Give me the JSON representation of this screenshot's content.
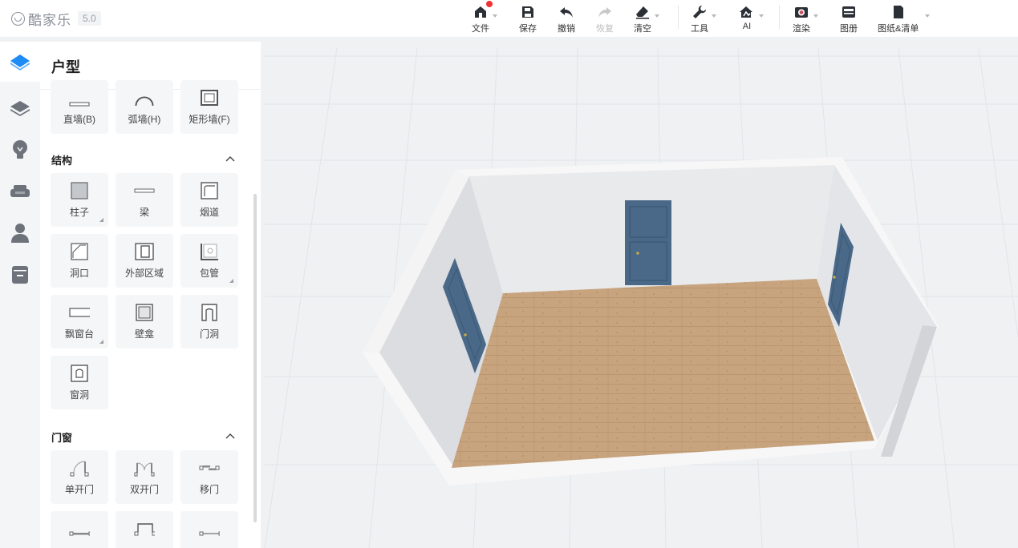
{
  "app": {
    "logo_text": "酷家乐",
    "version": "5.0"
  },
  "toolbar": {
    "file": "文件",
    "save": "保存",
    "undo": "撤销",
    "redo": "恢复",
    "clear": "清空",
    "tools": "工具",
    "ai": "AI",
    "render": "渲染",
    "album": "图册",
    "drawings": "图纸&清单"
  },
  "panel": {
    "title": "户型",
    "walls": [
      {
        "label": "直墙(B)",
        "icon": "straight-wall-icon"
      },
      {
        "label": "弧墙(H)",
        "icon": "arc-wall-icon"
      },
      {
        "label": "矩形墙(F)",
        "icon": "rect-wall-icon"
      }
    ],
    "structure": {
      "heading": "结构",
      "items": [
        {
          "label": "柱子",
          "icon": "column-icon"
        },
        {
          "label": "梁",
          "icon": "beam-icon"
        },
        {
          "label": "烟道",
          "icon": "flue-icon"
        },
        {
          "label": "洞口",
          "icon": "opening-icon"
        },
        {
          "label": "外部区域",
          "icon": "outer-area-icon"
        },
        {
          "label": "包管",
          "icon": "pipe-cover-icon"
        },
        {
          "label": "飘窗台",
          "icon": "bay-window-icon"
        },
        {
          "label": "壁龛",
          "icon": "niche-icon"
        },
        {
          "label": "门洞",
          "icon": "door-opening-icon"
        },
        {
          "label": "窗洞",
          "icon": "window-opening-icon"
        }
      ]
    },
    "doors_windows": {
      "heading": "门窗",
      "items": [
        {
          "label": "单开门",
          "icon": "single-door-icon"
        },
        {
          "label": "双开门",
          "icon": "double-door-icon"
        },
        {
          "label": "移门",
          "icon": "sliding-door-icon"
        }
      ]
    }
  },
  "colors": {
    "accent": "#1f8bf5",
    "floor": "#c9a783",
    "door": "#4b6a8a",
    "wall": "#e8e9ec"
  }
}
